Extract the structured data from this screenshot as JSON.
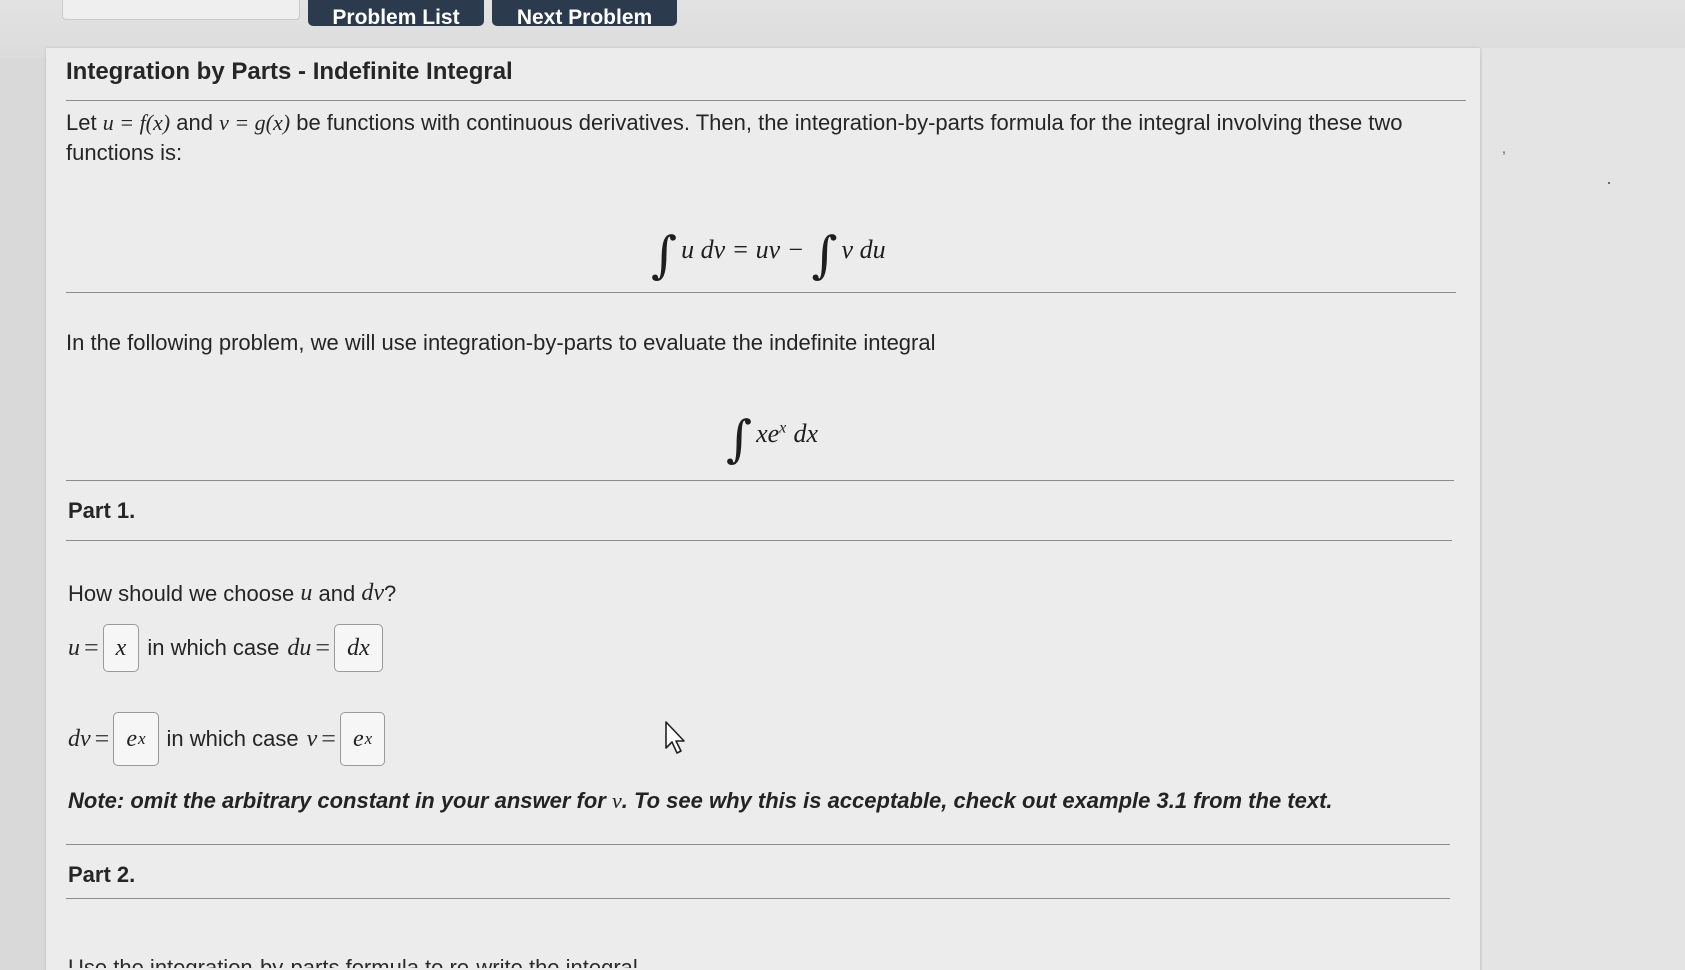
{
  "nav": {
    "problem_list": "Problem List",
    "next_problem": "Next Problem"
  },
  "title": "Integration by Parts - Indefinite Integral",
  "intro": {
    "let": "Let",
    "and": "and",
    "rest": "be functions with continuous derivatives. Then, the integration-by-parts formula for the integral involving these two functions is:",
    "u_def": "u = f(x)",
    "v_def": "v = g(x)"
  },
  "formula": {
    "lhs": "u dv = uv −",
    "rhs": "v du"
  },
  "problem": {
    "text": "In the following problem, we will use integration-by-parts to evaluate the indefinite integral",
    "integrand": "xe",
    "exponent": "x",
    "differential": "dx"
  },
  "part1": {
    "label": "Part 1.",
    "question_prefix": "How should we choose",
    "question_u": "u",
    "question_and": "and",
    "question_dv": "dv",
    "question_suffix": "?",
    "row1": {
      "var": "u",
      "answer": "x",
      "middle": "in which case",
      "var2": "du",
      "answer2": "dx"
    },
    "row2": {
      "var": "dv",
      "answer_base": "e",
      "answer_exp": "x",
      "middle": "in which case",
      "var2": "v",
      "answer2_base": "e",
      "answer2_exp": "x"
    },
    "note_prefix": "Note: omit the arbitrary constant in your answer for",
    "note_var": "v",
    "note_suffix": ". To see why this is acceptable, check out example 3.1 from the text."
  },
  "part2": {
    "label": "Part 2.",
    "text": "Use the integration-by-parts formula to re-write the integral"
  }
}
